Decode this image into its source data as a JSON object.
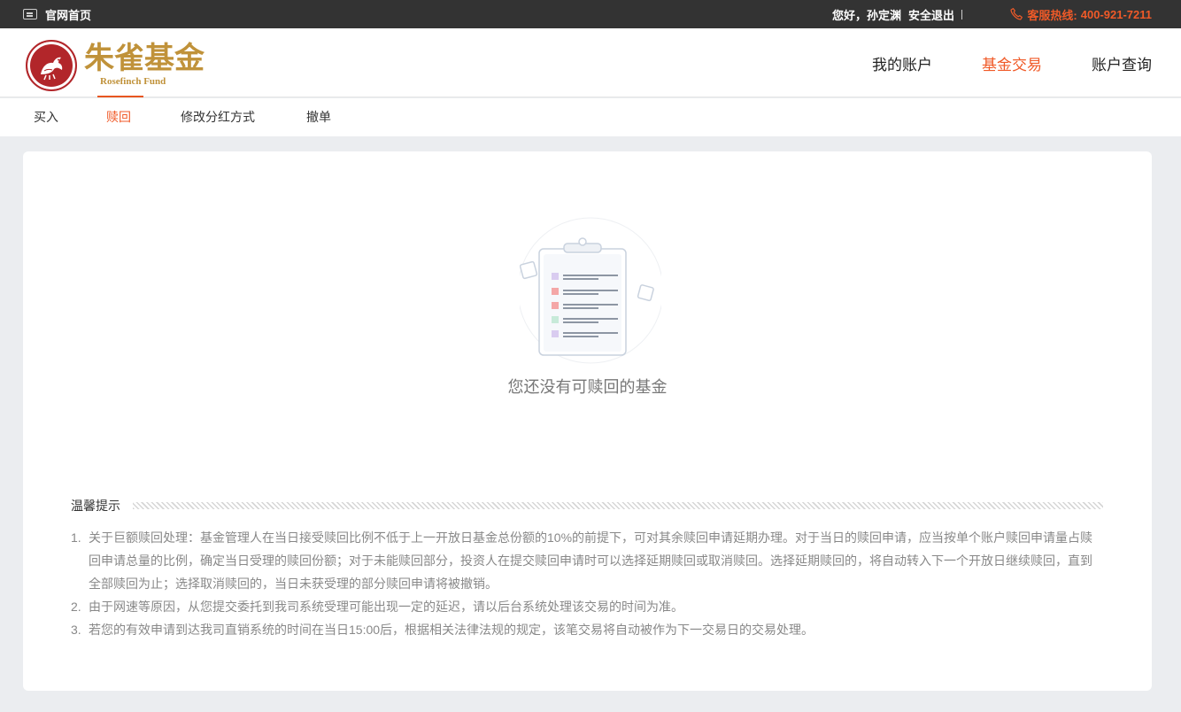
{
  "topbar": {
    "home_label": "官网首页",
    "greeting": "您好，孙定渊",
    "logout_label": "安全退出",
    "hotline_label": "客服热线:",
    "hotline_number": "400-921-7211"
  },
  "brand": {
    "name_cn": "朱雀基金",
    "name_en": "Rosefinch Fund",
    "logo_color": "#b2262a",
    "text_color": "#c0923a"
  },
  "main_nav": {
    "items": [
      {
        "label": "我的账户",
        "active": false
      },
      {
        "label": "基金交易",
        "active": true
      },
      {
        "label": "账户查询",
        "active": false
      }
    ]
  },
  "sub_nav": {
    "items": [
      {
        "label": "买入",
        "active": false
      },
      {
        "label": "赎回",
        "active": true
      },
      {
        "label": "修改分红方式",
        "active": false
      },
      {
        "label": "撤单",
        "active": false
      }
    ]
  },
  "empty_state": {
    "icon": "clipboard-icon",
    "message": "您还没有可赎回的基金"
  },
  "tips": {
    "title": "温馨提示",
    "items": [
      {
        "num": "1.",
        "text": "关于巨额赎回处理：基金管理人在当日接受赎回比例不低于上一开放日基金总份额的10%的前提下，可对其余赎回申请延期办理。对于当日的赎回申请，应当按单个账户赎回申请量占赎回申请总量的比例，确定当日受理的赎回份额；对于未能赎回部分，投资人在提交赎回申请时可以选择延期赎回或取消赎回。选择延期赎回的，将自动转入下一个开放日继续赎回，直到全部赎回为止；选择取消赎回的，当日未获受理的部分赎回申请将被撤销。"
      },
      {
        "num": "2.",
        "text": "由于网速等原因，从您提交委托到我司系统受理可能出现一定的延迟，请以后台系统处理该交易的时间为准。"
      },
      {
        "num": "3.",
        "text": "若您的有效申请到达我司直销系统的时间在当日15:00后，根据相关法律法规的规定，该笔交易将自动被作为下一交易日的交易处理。"
      }
    ]
  },
  "colors": {
    "accent": "#f05a28",
    "topbar_bg": "#333333",
    "page_bg": "#ebedf0"
  }
}
